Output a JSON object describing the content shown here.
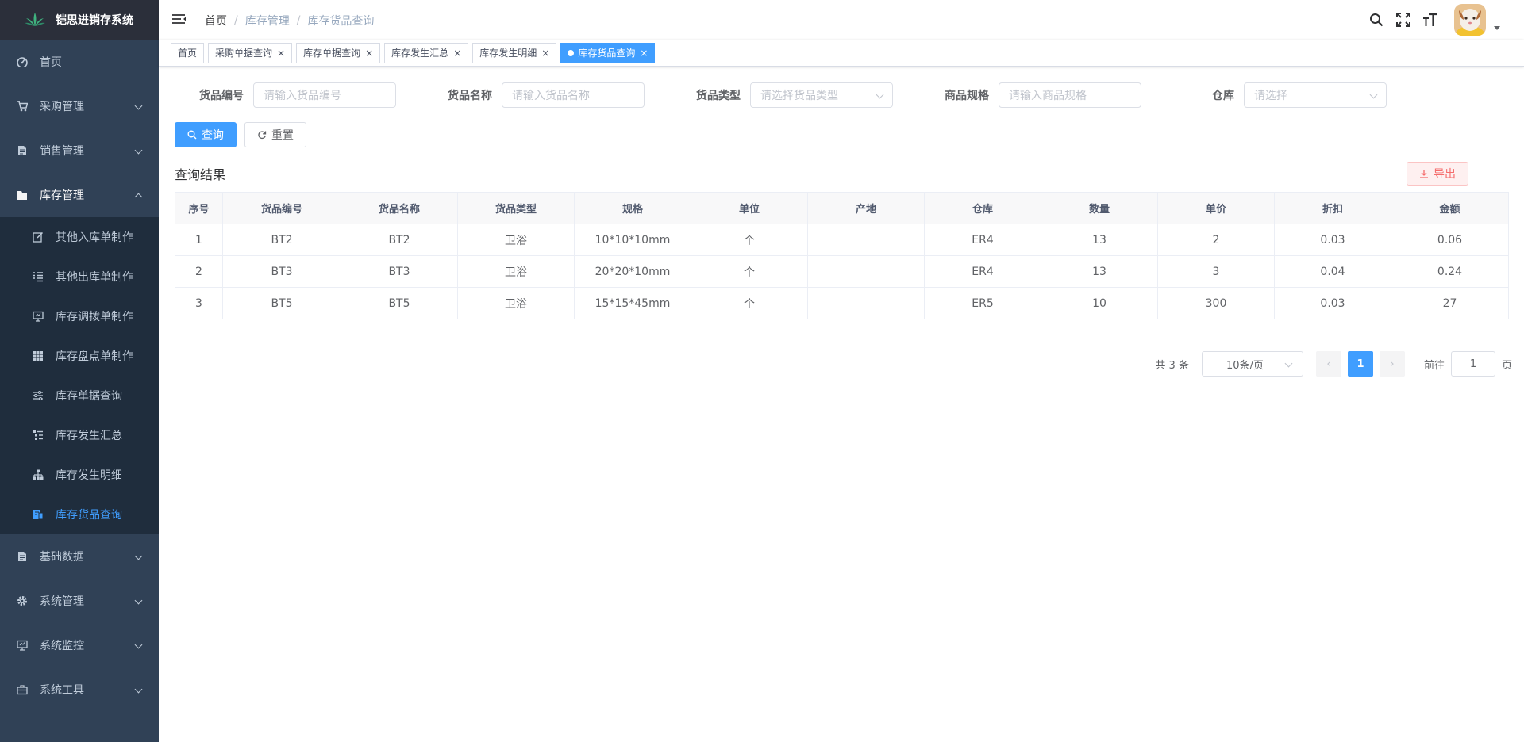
{
  "app": {
    "title": "铠思进销存系统"
  },
  "sidebar": {
    "items": [
      {
        "label": "首页",
        "icon": "dashboard-icon"
      },
      {
        "label": "采购管理",
        "icon": "cart-icon"
      },
      {
        "label": "销售管理",
        "icon": "document-icon"
      },
      {
        "label": "库存管理",
        "icon": "folder-icon"
      }
    ],
    "submenu": [
      {
        "label": "其他入库单制作",
        "icon": "edit-icon"
      },
      {
        "label": "其他出库单制作",
        "icon": "list-icon"
      },
      {
        "label": "库存调拨单制作",
        "icon": "monitor-icon"
      },
      {
        "label": "库存盘点单制作",
        "icon": "grid-icon"
      },
      {
        "label": "库存单据查询",
        "icon": "sliders-icon"
      },
      {
        "label": "库存发生汇总",
        "icon": "tree-table-icon"
      },
      {
        "label": "库存发生明细",
        "icon": "org-chart-icon"
      },
      {
        "label": "库存货品查询",
        "icon": "goods-icon"
      }
    ],
    "bottom_items": [
      {
        "label": "基础数据",
        "icon": "document-icon"
      },
      {
        "label": "系统管理",
        "icon": "gear-icon"
      },
      {
        "label": "系统监控",
        "icon": "monitor-icon"
      },
      {
        "label": "系统工具",
        "icon": "toolbox-icon"
      }
    ]
  },
  "breadcrumb": [
    "首页",
    "库存管理",
    "库存货品查询"
  ],
  "tags": [
    {
      "label": "首页",
      "closable": false
    },
    {
      "label": "采购单据查询",
      "closable": true
    },
    {
      "label": "库存单据查询",
      "closable": true
    },
    {
      "label": "库存发生汇总",
      "closable": true
    },
    {
      "label": "库存发生明细",
      "closable": true
    },
    {
      "label": "库存货品查询",
      "closable": true,
      "active": true
    }
  ],
  "form": {
    "goods_code": {
      "label": "货品编号",
      "placeholder": "请输入货品编号"
    },
    "goods_name": {
      "label": "货品名称",
      "placeholder": "请输入货品名称"
    },
    "goods_type": {
      "label": "货品类型",
      "placeholder": "请选择货品类型"
    },
    "spec": {
      "label": "商品规格",
      "placeholder": "请输入商品规格"
    },
    "warehouse": {
      "label": "仓库",
      "placeholder": "请选择"
    },
    "search_label": "查询",
    "reset_label": "重置"
  },
  "result": {
    "title": "查询结果",
    "export_label": "导出"
  },
  "table": {
    "columns": [
      "序号",
      "货品编号",
      "货品名称",
      "货品类型",
      "规格",
      "单位",
      "产地",
      "仓库",
      "数量",
      "单价",
      "折扣",
      "金额"
    ],
    "rows": [
      [
        "1",
        "BT2",
        "BT2",
        "卫浴",
        "10*10*10mm",
        "个",
        "",
        "ER4",
        "13",
        "2",
        "0.03",
        "0.06"
      ],
      [
        "2",
        "BT3",
        "BT3",
        "卫浴",
        "20*20*10mm",
        "个",
        "",
        "ER4",
        "13",
        "3",
        "0.04",
        "0.24"
      ],
      [
        "3",
        "BT5",
        "BT5",
        "卫浴",
        "15*15*45mm",
        "个",
        "",
        "ER5",
        "10",
        "300",
        "0.03",
        "27"
      ]
    ]
  },
  "pagination": {
    "total": "共 3 条",
    "page_size": "10条/页",
    "current_page": "1",
    "goto_label": "前往",
    "goto_value": "1",
    "page_suffix": "页"
  },
  "colors": {
    "sidebar_bg": "#304156",
    "submenu_bg": "#1f2d3d",
    "accent": "#409eff",
    "danger": "#f56c6c"
  }
}
